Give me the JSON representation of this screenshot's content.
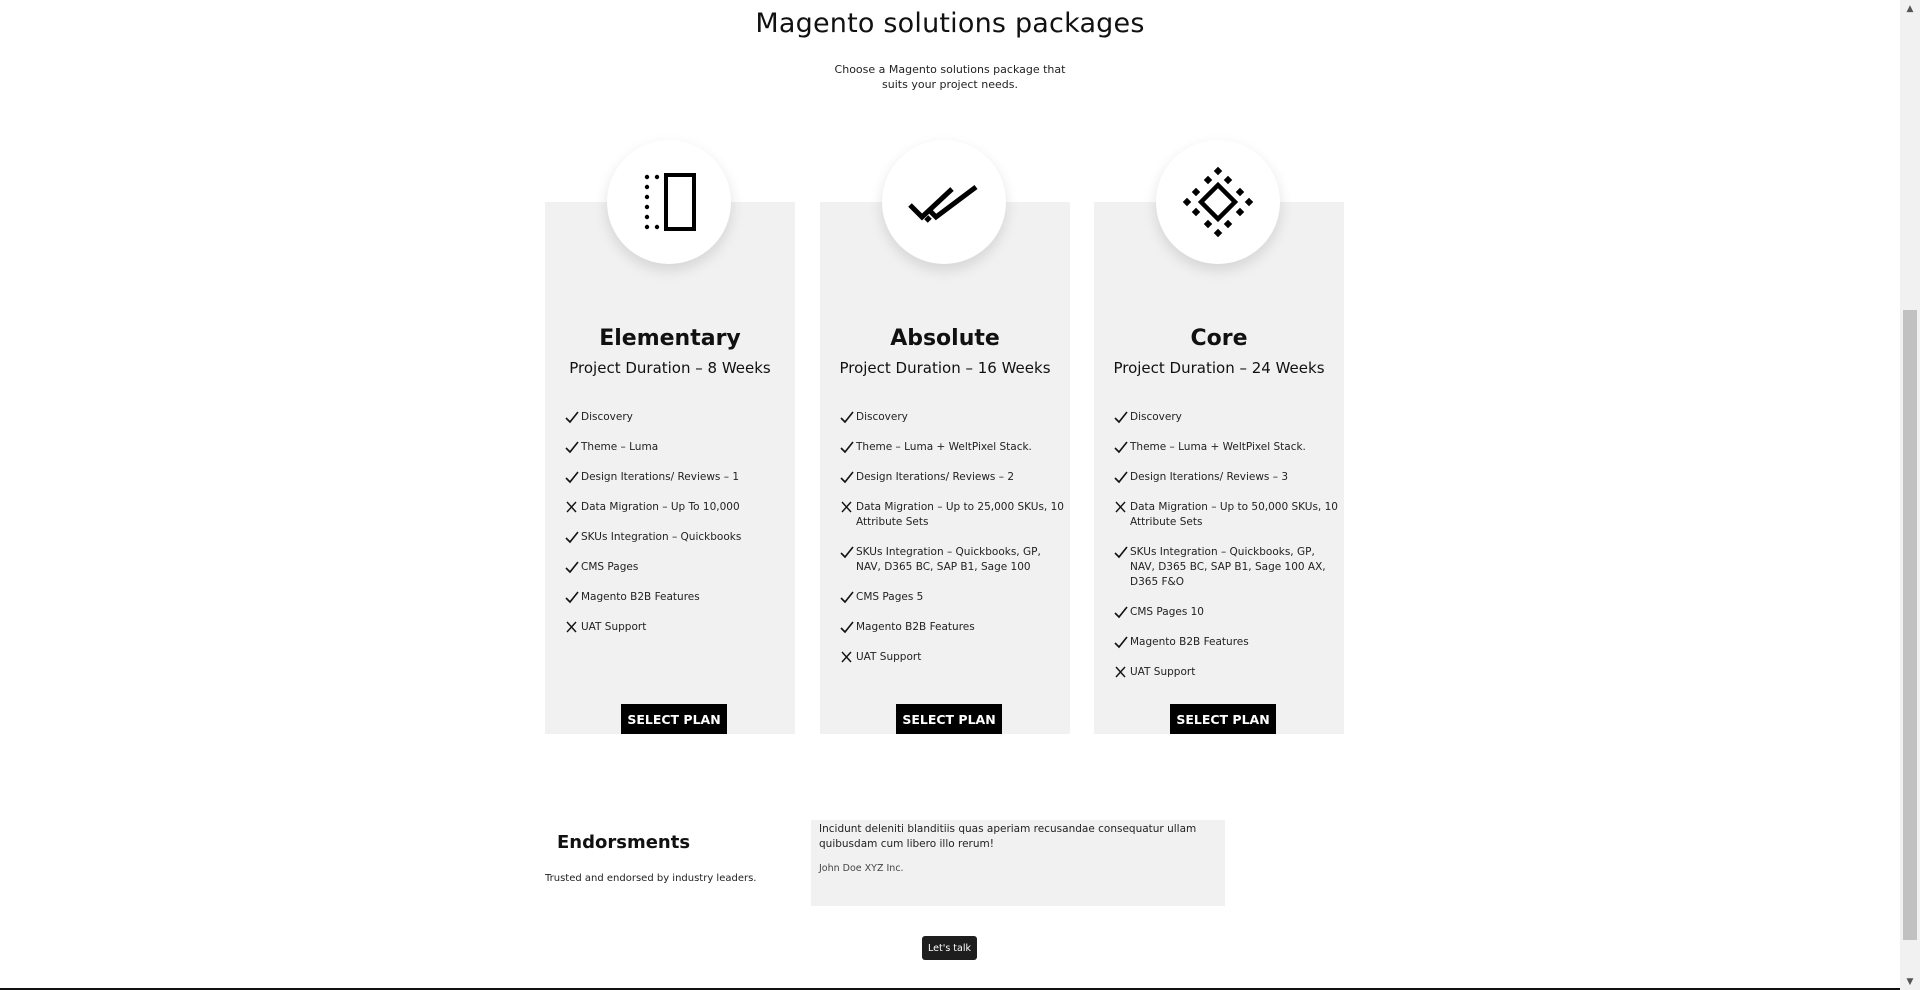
{
  "section": {
    "title": "Magento solutions packages",
    "subtitle": "Choose a Magento solutions package that suits your project needs."
  },
  "plans": [
    {
      "icon": "dotted-rectangle-icon",
      "name": "Elementary",
      "duration": "Project Duration – 8 Weeks",
      "button_label": "SELECT PLAN",
      "features": [
        {
          "text": "Discovery",
          "included": true
        },
        {
          "text": "Theme – Luma",
          "included": true
        },
        {
          "text": "Design Iterations/ Reviews – 1",
          "included": true
        },
        {
          "text": "Data Migration – Up To 10,000",
          "included": false
        },
        {
          "text": "SKUs Integration – Quickbooks",
          "included": true
        },
        {
          "text": "CMS Pages",
          "included": true
        },
        {
          "text": "Magento B2B Features",
          "included": true
        },
        {
          "text": "UAT Support",
          "included": false
        }
      ]
    },
    {
      "icon": "double-check-icon",
      "name": "Absolute",
      "duration": "Project Duration – 16 Weeks",
      "button_label": "SELECT PLAN",
      "features": [
        {
          "text": "Discovery",
          "included": true
        },
        {
          "text": "Theme – Luma + WeltPixel Stack.",
          "included": true
        },
        {
          "text": "Design Iterations/ Reviews – 2",
          "included": true
        },
        {
          "text": "Data Migration – Up to 25,000 SKUs, 10 Attribute Sets",
          "included": false
        },
        {
          "text": "SKUs Integration – Quickbooks, GP, NAV, D365 BC, SAP B1, Sage 100",
          "included": true
        },
        {
          "text": "CMS Pages 5",
          "included": true
        },
        {
          "text": "Magento B2B Features",
          "included": true
        },
        {
          "text": "UAT Support",
          "included": false
        }
      ]
    },
    {
      "icon": "diamond-pattern-icon",
      "name": "Core",
      "duration": "Project Duration – 24 Weeks",
      "button_label": "SELECT PLAN",
      "features": [
        {
          "text": "Discovery",
          "included": true
        },
        {
          "text": "Theme – Luma + WeltPixel Stack.",
          "included": true
        },
        {
          "text": "Design Iterations/ Reviews – 3",
          "included": true
        },
        {
          "text": "Data Migration – Up to 50,000 SKUs, 10 Attribute Sets",
          "included": false
        },
        {
          "text": "SKUs Integration – Quickbooks, GP, NAV, D365 BC, SAP B1, Sage 100 AX, D365 F&O",
          "included": true
        },
        {
          "text": "CMS Pages 10",
          "included": true
        },
        {
          "text": "Magento B2B Features",
          "included": true
        },
        {
          "text": "UAT Support",
          "included": false
        }
      ]
    }
  ],
  "endorsements": {
    "title": "Endorsments",
    "subtitle": "Trusted and endorsed by industry leaders.",
    "quote": "Incidunt deleniti blanditiis quas aperiam recusandae consequatur ullam quibusdam cum libero illo rerum!",
    "author": "John Doe XYZ Inc."
  },
  "cta": {
    "label": "Let's talk"
  }
}
